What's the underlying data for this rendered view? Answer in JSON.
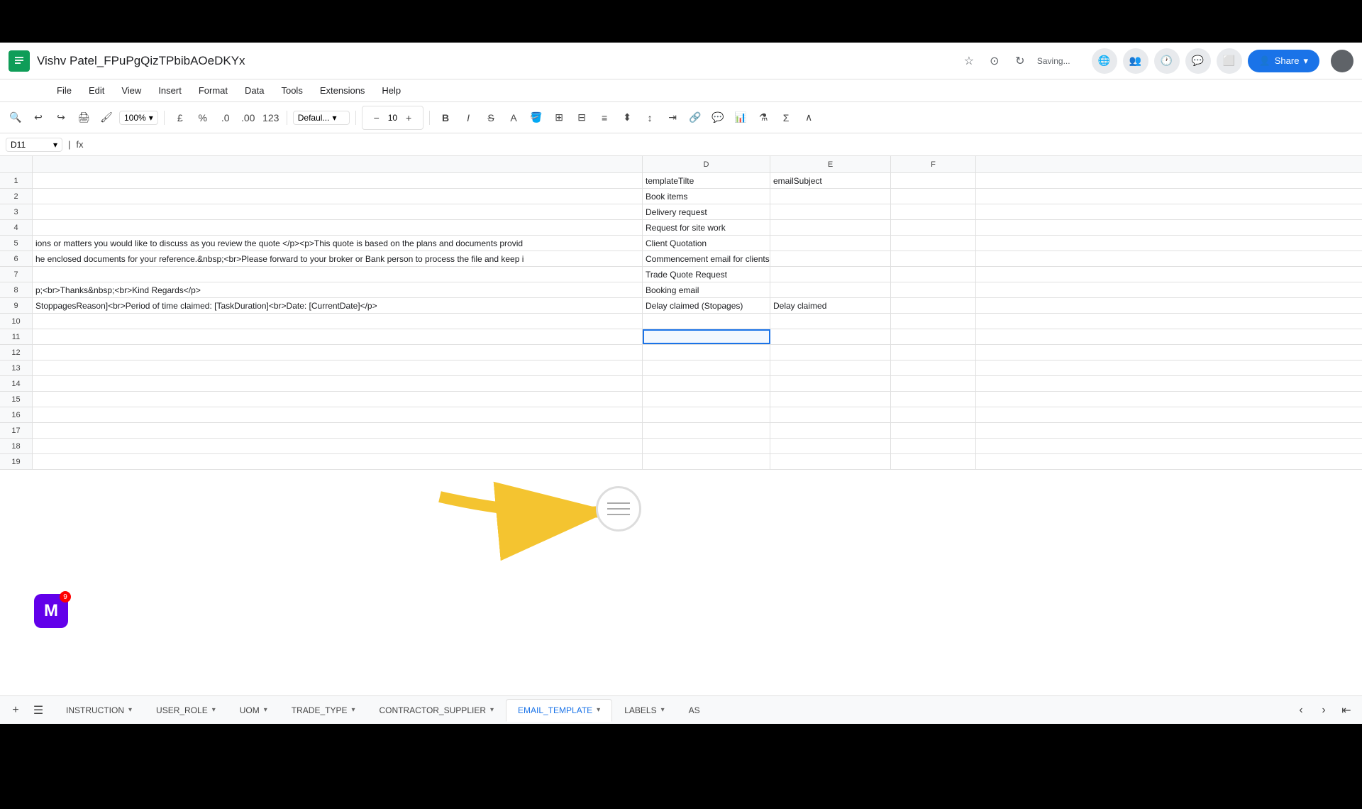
{
  "title_bar": {
    "logo_letter": "S",
    "doc_title": "Vishv Patel_FPuPgQizTPbibAOeDKYx",
    "saving_text": "Saving...",
    "share_label": "Share"
  },
  "menu": {
    "items": [
      "File",
      "Edit",
      "View",
      "Insert",
      "Format",
      "Data",
      "Tools",
      "Extensions",
      "Help"
    ]
  },
  "toolbar": {
    "zoom": "100%",
    "currency_symbol": "£",
    "percent_symbol": "%",
    "format_0": ".0",
    "format_00": ".00",
    "format_123": "123",
    "font_family": "Defaul...",
    "font_size": "10"
  },
  "formula_bar": {
    "cell_ref": "D11",
    "formula_content": ""
  },
  "columns": {
    "headers": [
      "D",
      "E",
      "F"
    ],
    "widths": [
      180,
      170,
      120
    ]
  },
  "rows": [
    {
      "num": 1,
      "cells": {
        "abc": "",
        "d": "templateTilte",
        "e": "emailSubject",
        "f": ""
      }
    },
    {
      "num": 2,
      "cells": {
        "abc": "",
        "d": "Book items",
        "e": "",
        "f": ""
      }
    },
    {
      "num": 3,
      "cells": {
        "abc": "",
        "d": "Delivery request",
        "e": "",
        "f": ""
      }
    },
    {
      "num": 4,
      "cells": {
        "abc": "",
        "d": "Request for site work",
        "e": "",
        "f": ""
      }
    },
    {
      "num": 5,
      "cells": {
        "abc": "ions or matters you would like to discuss as you review the quote </p><p>This quote is based on the plans and documents provid",
        "d": "Client Quotation",
        "e": "",
        "f": ""
      }
    },
    {
      "num": 6,
      "cells": {
        "abc": "he enclosed documents for your reference.&nbsp;<br>Please forward to your broker or Bank person to process the file and keep i",
        "d": "Commencement email for clients",
        "e": "",
        "f": ""
      }
    },
    {
      "num": 7,
      "cells": {
        "abc": "",
        "d": "Trade Quote Request",
        "e": "",
        "f": ""
      }
    },
    {
      "num": 8,
      "cells": {
        "abc": "p;<br>Thanks&nbsp;<br>Kind Regards</p>",
        "d": "Booking email",
        "e": "",
        "f": ""
      }
    },
    {
      "num": 9,
      "cells": {
        "abc": "StoppagesReason]<br>Period of time claimed: [TaskDuration]<br>Date: [CurrentDate]</p>",
        "d": "Delay claimed (Stopages)",
        "e": "Delay claimed",
        "f": ""
      }
    },
    {
      "num": 10,
      "cells": {
        "abc": "",
        "d": "",
        "e": "",
        "f": ""
      }
    },
    {
      "num": 11,
      "cells": {
        "abc": "",
        "d": "",
        "e": "",
        "f": "",
        "selected": true
      }
    },
    {
      "num": 12,
      "cells": {
        "abc": "",
        "d": "",
        "e": "",
        "f": ""
      }
    },
    {
      "num": 13,
      "cells": {
        "abc": "",
        "d": "",
        "e": "",
        "f": ""
      }
    },
    {
      "num": 14,
      "cells": {
        "abc": "",
        "d": "",
        "e": "",
        "f": ""
      }
    },
    {
      "num": 15,
      "cells": {
        "abc": "",
        "d": "",
        "e": "",
        "f": ""
      }
    },
    {
      "num": 16,
      "cells": {
        "abc": "",
        "d": "",
        "e": "",
        "f": ""
      }
    },
    {
      "num": 17,
      "cells": {
        "abc": "",
        "d": "",
        "e": "",
        "f": ""
      }
    },
    {
      "num": 18,
      "cells": {
        "abc": "",
        "d": "",
        "e": "",
        "f": ""
      }
    },
    {
      "num": 19,
      "cells": {
        "abc": "",
        "d": "",
        "e": "",
        "f": ""
      }
    }
  ],
  "sheet_tabs": [
    {
      "label": "INSTRUCTION",
      "active": false
    },
    {
      "label": "USER_ROLE",
      "active": false
    },
    {
      "label": "UOM",
      "active": false
    },
    {
      "label": "TRADE_TYPE",
      "active": false
    },
    {
      "label": "CONTRACTOR_SUPPLIER",
      "active": false
    },
    {
      "label": "EMAIL_TEMPLATE",
      "active": true
    },
    {
      "label": "LABELS",
      "active": false
    },
    {
      "label": "AS",
      "active": false
    }
  ],
  "notification": {
    "count": "9"
  }
}
